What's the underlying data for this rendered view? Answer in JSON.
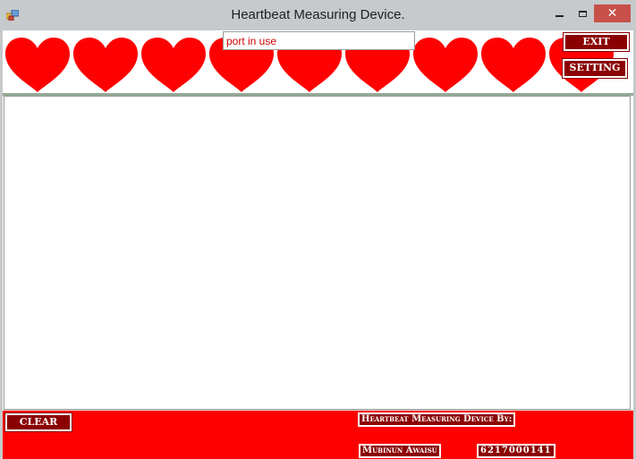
{
  "window": {
    "title": "Heartbeat Measuring Device.",
    "icon": "app-form-icon",
    "controls": {
      "minimize": "minimize-icon",
      "maximize": "maximize-icon",
      "close_glyph": "✕"
    }
  },
  "header": {
    "status_text": "port in use",
    "heart_icon": "heart-icon",
    "heart_color": "#ff0000",
    "heart_count": 9,
    "exit_label": "EXIT",
    "setting_label": "SETTING"
  },
  "footer": {
    "background": "#ff0000",
    "clear_label": "CLEAR",
    "credit_heading": "Heartbeat Measuring Device By:",
    "author_name": "Mubinun Awaisu",
    "author_id": "6217000141"
  },
  "colors": {
    "button_fill": "#8b0000",
    "status_text": "#cc0000",
    "separator": "#93aa93"
  }
}
